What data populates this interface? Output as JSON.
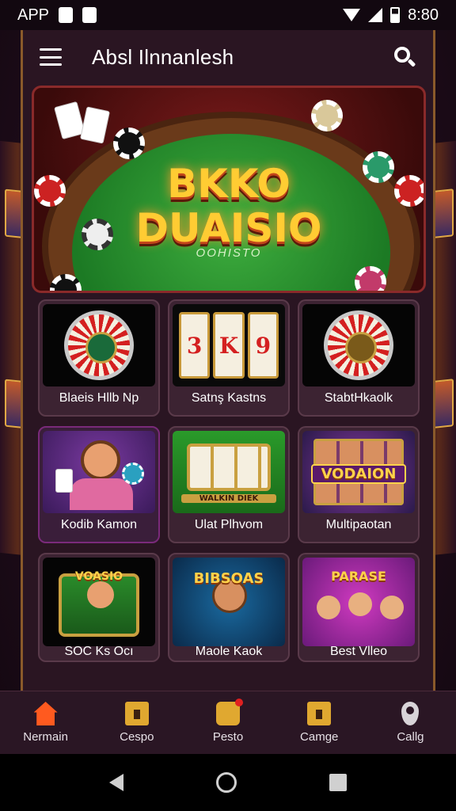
{
  "status_bar": {
    "carrier": "APP",
    "time": "8:80"
  },
  "header": {
    "title": "Absl Ilnnanlesh"
  },
  "hero": {
    "title_line1": "BKKO",
    "title_line2": "DUAISIO",
    "subtitle": "OOHISTO"
  },
  "games": [
    {
      "label": "Blaeis Hllb Np"
    },
    {
      "label": "Satnş Kastns",
      "reels": [
        "3",
        "K",
        "9"
      ]
    },
    {
      "label": "StabtHkaolk"
    },
    {
      "label": "Kodib Kamon"
    },
    {
      "label": "Ulat Plhvom",
      "banner": "WALKIN DIEK"
    },
    {
      "label": "Multipaotan",
      "banner": "VODAION"
    },
    {
      "label": "SOC Ks Ocı",
      "banner": "VOASIO"
    },
    {
      "label": "Maole Kaok",
      "banner": "BIBSOAS"
    },
    {
      "label": "Best Vlleo",
      "banner": "PARASE"
    }
  ],
  "bottom_nav": [
    {
      "label": "Nermain",
      "icon": "home-icon"
    },
    {
      "label": "Cespo",
      "icon": "box-icon"
    },
    {
      "label": "Pesto",
      "icon": "dice-icon"
    },
    {
      "label": "Camge",
      "icon": "box-icon"
    },
    {
      "label": "Callg",
      "icon": "pin-icon"
    }
  ],
  "colors": {
    "accent": "#ff5a1f",
    "gold": "#ffcc33",
    "felt": "#1c7a24"
  }
}
